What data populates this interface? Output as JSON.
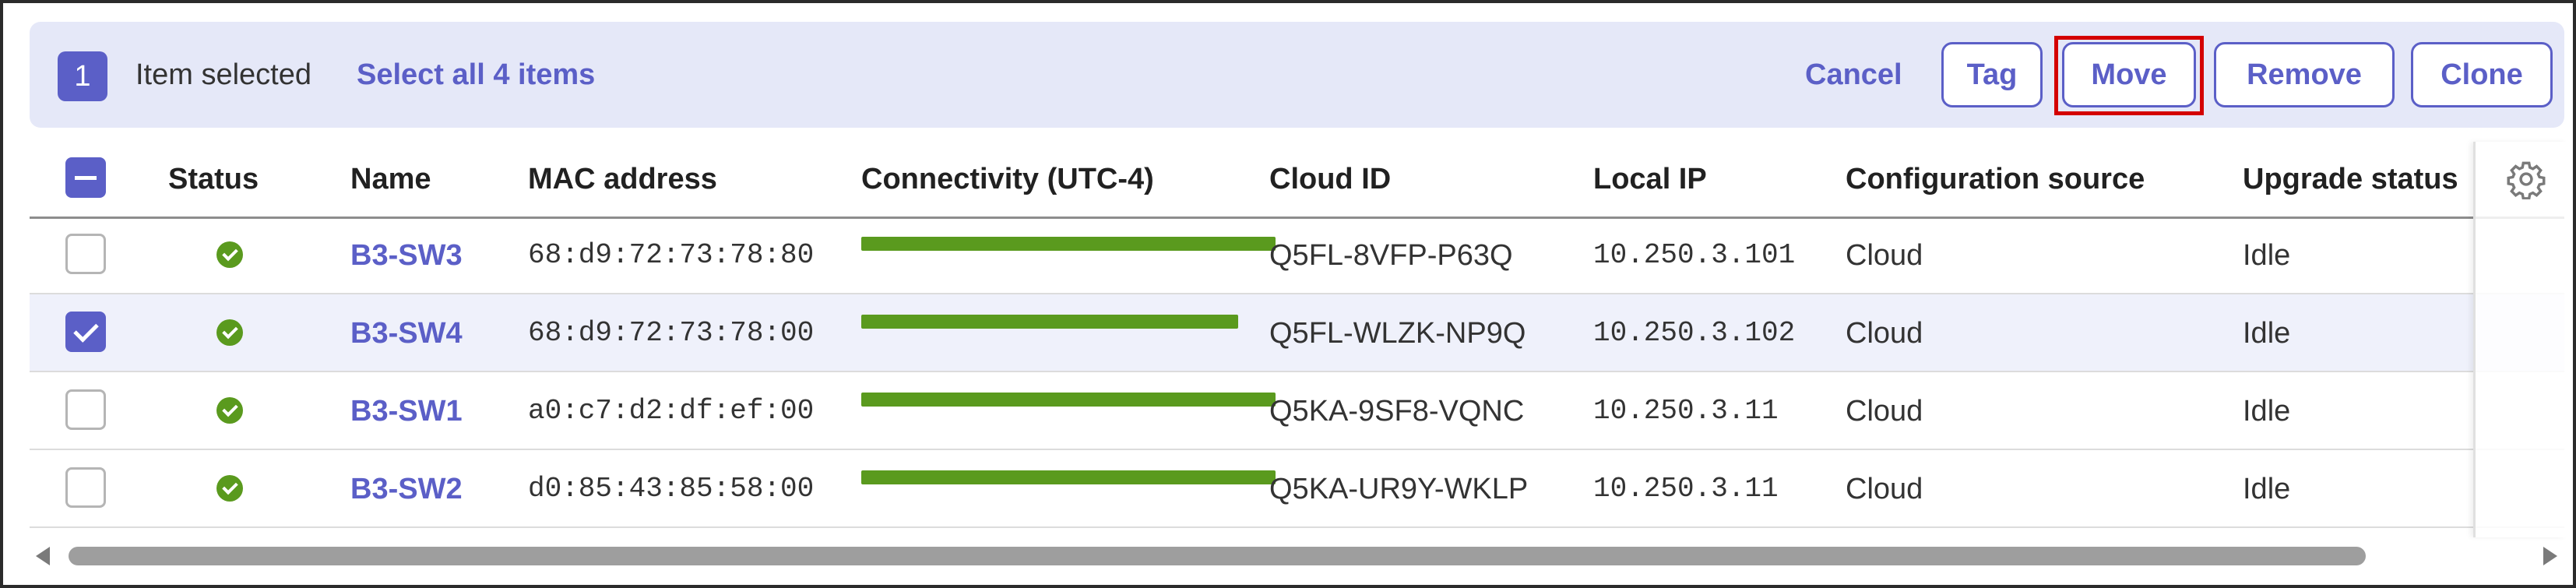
{
  "selection_bar": {
    "count": "1",
    "text": "Item selected",
    "select_all_label": "Select all 4 items",
    "cancel_label": "Cancel",
    "buttons": [
      "Tag",
      "Move",
      "Remove",
      "Clone"
    ]
  },
  "table": {
    "columns": [
      "Status",
      "Name",
      "MAC address",
      "Connectivity (UTC-4)",
      "Cloud ID",
      "Local IP",
      "Configuration source",
      "Upgrade status"
    ],
    "rows": [
      {
        "selected": false,
        "status": "online",
        "name": "B3-SW3",
        "mac": "68:d9:72:73:78:80",
        "connectivity_fraction": 1.0,
        "cloud_id": "Q5FL-8VFP-P63Q",
        "local_ip": "10.250.3.101",
        "config_source": "Cloud",
        "upgrade_status": "Idle"
      },
      {
        "selected": true,
        "status": "online",
        "name": "B3-SW4",
        "mac": "68:d9:72:73:78:00",
        "connectivity_fraction": 0.91,
        "cloud_id": "Q5FL-WLZK-NP9Q",
        "local_ip": "10.250.3.102",
        "config_source": "Cloud",
        "upgrade_status": "Idle"
      },
      {
        "selected": false,
        "status": "online",
        "name": "B3-SW1",
        "mac": "a0:c7:d2:df:ef:00",
        "connectivity_fraction": 1.0,
        "cloud_id": "Q5KA-9SF8-VQNC",
        "local_ip": "10.250.3.11",
        "config_source": "Cloud",
        "upgrade_status": "Idle"
      },
      {
        "selected": false,
        "status": "online",
        "name": "B3-SW2",
        "mac": "d0:85:43:85:58:00",
        "connectivity_fraction": 1.0,
        "cloud_id": "Q5KA-UR9Y-WKLP",
        "local_ip": "10.250.3.11",
        "config_source": "Cloud",
        "upgrade_status": "Idle"
      }
    ]
  },
  "colors": {
    "accent": "#5b5fc7",
    "status_ok": "#5a9a1e",
    "highlight": "#d40000",
    "selection_bar_bg": "#e5e8f8"
  },
  "icons": {
    "settings": "gear-icon",
    "status": "check-circle-icon"
  }
}
